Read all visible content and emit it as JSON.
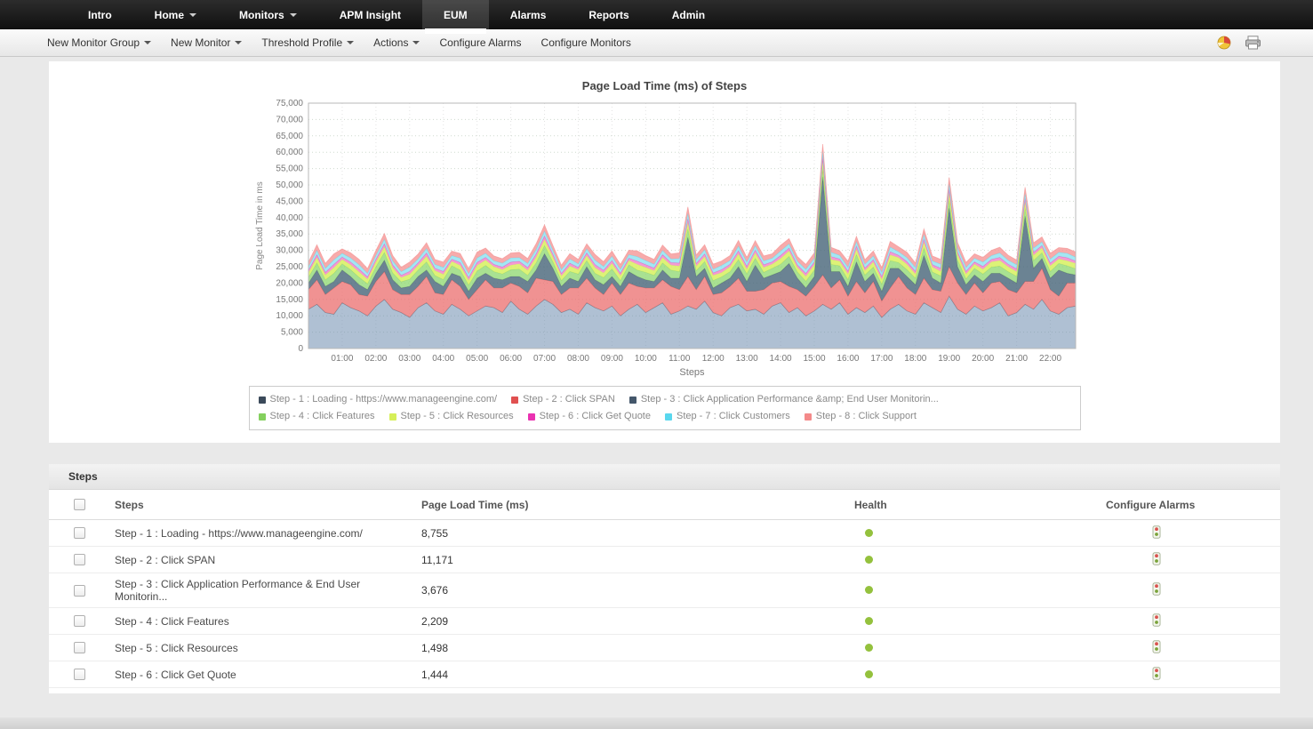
{
  "nav": {
    "items": [
      {
        "label": "Intro",
        "caret": false,
        "active": false
      },
      {
        "label": "Home",
        "caret": true,
        "active": false
      },
      {
        "label": "Monitors",
        "caret": true,
        "active": false
      },
      {
        "label": "APM Insight",
        "caret": false,
        "active": false
      },
      {
        "label": "EUM",
        "caret": false,
        "active": true
      },
      {
        "label": "Alarms",
        "caret": false,
        "active": false
      },
      {
        "label": "Reports",
        "caret": false,
        "active": false
      },
      {
        "label": "Admin",
        "caret": false,
        "active": false
      }
    ]
  },
  "toolbar": {
    "items": [
      {
        "label": "New Monitor Group",
        "caret": true
      },
      {
        "label": "New Monitor",
        "caret": true
      },
      {
        "label": "Threshold Profile",
        "caret": true
      },
      {
        "label": "Actions",
        "caret": true
      },
      {
        "label": "Configure Alarms",
        "caret": false
      },
      {
        "label": "Configure Monitors",
        "caret": false
      }
    ]
  },
  "chart_data": {
    "type": "area",
    "stacked": true,
    "title": "Page Load Time (ms) of Steps",
    "ylabel": "Page Load Time in ms",
    "xlabel": "Steps",
    "ylim": [
      0,
      75000
    ],
    "ytick_step": 5000,
    "grid": true,
    "legend_position": "bottom",
    "x_interval_minutes": 15,
    "x_ticks": [
      "01:00",
      "02:00",
      "03:00",
      "04:00",
      "05:00",
      "06:00",
      "07:00",
      "08:00",
      "09:00",
      "10:00",
      "11:00",
      "12:00",
      "13:00",
      "14:00",
      "15:00",
      "16:00",
      "17:00",
      "18:00",
      "19:00",
      "20:00",
      "21:00",
      "22:00"
    ],
    "legend_rows": [
      [
        0,
        1,
        2
      ],
      [
        3,
        4,
        5,
        6,
        7
      ]
    ],
    "series": [
      {
        "name": "Step - 1 : Loading - https://www.manageengine.com/",
        "marker": "#3b4a5a",
        "fill": "rgba(110,140,175,0.55)",
        "values": [
          12000,
          13500,
          11000,
          10500,
          14000,
          12500,
          11500,
          10000,
          13000,
          15000,
          12000,
          11000,
          9500,
          12500,
          14000,
          11500,
          10500,
          13500,
          12000,
          10000,
          11500,
          13000,
          12500,
          11000,
          14500,
          12000,
          10500,
          13000,
          15000,
          13500,
          11000,
          12000,
          10500,
          14000,
          12500,
          11500,
          13000,
          10000,
          12000,
          13500,
          11000,
          12500,
          14000,
          10500,
          11500,
          13000,
          12000,
          14500,
          11000,
          10000,
          12500,
          13500,
          11500,
          12000,
          10500,
          13000,
          14000,
          11000,
          12500,
          10000,
          11500,
          13500,
          12000,
          14000,
          10500,
          12500,
          11000,
          13000,
          9500,
          12000,
          13500,
          11500,
          10500,
          14000,
          12500,
          11000,
          16000,
          12000,
          10500,
          13000,
          11500,
          12500,
          14000,
          10000,
          11000,
          13500,
          12000,
          15000,
          11500,
          10500,
          12500,
          13000
        ]
      },
      {
        "name": "Step - 2 : Click SPAN",
        "marker": "#e05050",
        "fill": "rgba(235,110,110,0.75)",
        "values": [
          6000,
          7500,
          5500,
          8000,
          6500,
          7000,
          5000,
          6000,
          7500,
          8500,
          6000,
          5500,
          7000,
          6500,
          8000,
          5500,
          6000,
          7500,
          7000,
          5000,
          6500,
          8000,
          6000,
          7500,
          5500,
          7000,
          6500,
          8500,
          6000,
          7000,
          5500,
          6500,
          8000,
          7500,
          6000,
          5000,
          7000,
          6500,
          8000,
          5500,
          7500,
          6000,
          7000,
          8500,
          6500,
          9000,
          6000,
          7500,
          5500,
          7000,
          6500,
          8000,
          6000,
          5500,
          7500,
          7000,
          6500,
          8000,
          5500,
          6000,
          7500,
          9000,
          6500,
          7000,
          5500,
          8000,
          6000,
          7500,
          5000,
          6500,
          8500,
          7000,
          6000,
          7500,
          5500,
          6500,
          9000,
          8000,
          6000,
          7000,
          5500,
          7500,
          6500,
          8000,
          6000,
          7000,
          8500,
          9500,
          6500,
          5500,
          7500,
          7000
        ]
      },
      {
        "name": "Step - 3 : Click Application Performance &amp; End User Monitorin...",
        "marker": "#44576b",
        "fill": "rgba(70,100,120,0.80)",
        "values": [
          2000,
          3000,
          2500,
          2000,
          3500,
          2500,
          3000,
          2000,
          2500,
          3500,
          3000,
          2000,
          2500,
          3000,
          2000,
          3500,
          2500,
          2000,
          3000,
          2500,
          3500,
          2000,
          3000,
          2500,
          2000,
          3000,
          3500,
          2500,
          8000,
          4000,
          2500,
          3000,
          2000,
          3500,
          2500,
          3000,
          2000,
          2500,
          3500,
          3000,
          2500,
          2000,
          3000,
          2500,
          3500,
          12000,
          4000,
          2500,
          2000,
          3000,
          2500,
          3500,
          3000,
          8000,
          3500,
          2500,
          3000,
          7000,
          3500,
          2500,
          3000,
          30000,
          5000,
          2500,
          3000,
          6000,
          3500,
          2500,
          3000,
          6000,
          2500,
          3500,
          3000,
          7000,
          3500,
          2500,
          18000,
          5000,
          3000,
          2500,
          3500,
          3000,
          2500,
          3500,
          3000,
          20000,
          4000,
          3000,
          3500,
          8000,
          3000,
          2500
        ]
      },
      {
        "name": "Step - 4 : Click Features",
        "marker": "#84d05e",
        "fill": "rgba(140,215,110,0.75)",
        "values": [
          1800,
          2200,
          2000,
          2500,
          1900,
          2100,
          2300,
          1800,
          2000,
          2400,
          2100,
          1900,
          2200,
          2000,
          2500,
          1800,
          2100,
          2300,
          2000,
          1900,
          2200,
          2400,
          2000,
          1800,
          2100,
          2300,
          1900,
          2200,
          2500,
          2000,
          1800,
          2100,
          2300,
          1900,
          2000,
          2200,
          2400,
          1800,
          2100,
          2000,
          2300,
          1900,
          2200,
          2500,
          2000,
          2600,
          1800,
          2100,
          2300,
          1900,
          2000,
          2200,
          2400,
          2100,
          1800,
          2000,
          2300,
          2200,
          1900,
          2100,
          2000,
          2800,
          2200,
          1800,
          2100,
          2300,
          2000,
          1900,
          2200,
          2400,
          1800,
          2100,
          2000,
          2300,
          1900,
          2200,
          2600,
          2100,
          1800,
          2000,
          2300,
          1900,
          2200,
          2000,
          2100,
          2500,
          2400,
          1800,
          2100,
          2000,
          2300,
          1900
        ]
      },
      {
        "name": "Step - 5 : Click Resources",
        "marker": "#d6ef59",
        "fill": "rgba(215,240,95,0.85)",
        "values": [
          1400,
          1600,
          1500,
          1700,
          1300,
          1500,
          1600,
          1400,
          1500,
          1700,
          1600,
          1300,
          1500,
          1400,
          1700,
          1500,
          1600,
          1300,
          1400,
          1500,
          1700,
          1600,
          1500,
          1300,
          1400,
          1600,
          1500,
          1700,
          1800,
          1500,
          1400,
          1600,
          1300,
          1500,
          1700,
          1400,
          1600,
          1500,
          1300,
          1700,
          1500,
          1400,
          1600,
          1500,
          1700,
          1900,
          1400,
          1500,
          1600,
          1300,
          1500,
          1700,
          1400,
          1600,
          1500,
          1300,
          1700,
          1600,
          1400,
          1500,
          1600,
          2000,
          1500,
          1400,
          1700,
          1600,
          1300,
          1500,
          1400,
          1700,
          1500,
          1600,
          1300,
          1700,
          1500,
          1400,
          1900,
          1600,
          1500,
          1300,
          1400,
          1600,
          1700,
          1500,
          1400,
          1800,
          1600,
          1500,
          1700,
          1400,
          1500,
          1600
        ]
      },
      {
        "name": "Step - 6 : Click Get Quote",
        "marker": "#ea32b1",
        "fill": "rgba(240,130,200,0.80)",
        "values": [
          700,
          900,
          800,
          1000,
          750,
          850,
          900,
          700,
          800,
          950,
          850,
          700,
          900,
          800,
          1000,
          750,
          850,
          700,
          900,
          800,
          950,
          850,
          700,
          800,
          900,
          750,
          850,
          1000,
          1100,
          800,
          750,
          900,
          700,
          850,
          950,
          800,
          900,
          750,
          700,
          1000,
          850,
          800,
          900,
          750,
          950,
          1200,
          800,
          850,
          700,
          900,
          750,
          1000,
          850,
          900,
          800,
          700,
          950,
          900,
          750,
          850,
          800,
          1300,
          900,
          700,
          850,
          950,
          800,
          750,
          900,
          1000,
          700,
          850,
          800,
          950,
          750,
          900,
          1200,
          850,
          800,
          700,
          900,
          750,
          950,
          800,
          850,
          1100,
          900,
          700,
          850,
          800,
          950,
          750
        ]
      },
      {
        "name": "Step - 7 : Click Customers",
        "marker": "#59d7ee",
        "fill": "rgba(140,225,240,0.80)",
        "values": [
          1100,
          1300,
          1200,
          1400,
          1150,
          1250,
          1300,
          1100,
          1200,
          1350,
          1250,
          1100,
          1300,
          1200,
          1400,
          1150,
          1250,
          1100,
          1300,
          1200,
          1350,
          1250,
          1100,
          1200,
          1300,
          1150,
          1250,
          1400,
          1500,
          1200,
          1150,
          1300,
          1100,
          1250,
          1350,
          1200,
          1300,
          1150,
          1100,
          1400,
          1250,
          1200,
          1300,
          1150,
          1350,
          1600,
          1200,
          1250,
          1100,
          1300,
          1150,
          1400,
          1250,
          1300,
          1200,
          1100,
          1350,
          1300,
          1150,
          1250,
          1200,
          1700,
          1300,
          1100,
          1250,
          1350,
          1200,
          1150,
          1300,
          1400,
          1100,
          1250,
          1200,
          1350,
          1150,
          1300,
          1600,
          1250,
          1200,
          1100,
          1300,
          1150,
          1350,
          1200,
          1250,
          1500,
          1300,
          1100,
          1250,
          1200,
          1350,
          1150
        ]
      },
      {
        "name": "Step - 8 : Click Support",
        "marker": "#f48a8a",
        "fill": "rgba(245,150,150,0.80)",
        "values": [
          1400,
          1700,
          1500,
          1800,
          1350,
          1550,
          1650,
          1400,
          1500,
          1750,
          1600,
          1350,
          1550,
          1450,
          1750,
          1500,
          1600,
          1350,
          1450,
          1500,
          1750,
          1600,
          1500,
          1350,
          1450,
          1600,
          1500,
          1750,
          1900,
          1500,
          1400,
          1600,
          1350,
          1500,
          1750,
          1450,
          1600,
          1500,
          1350,
          1750,
          1500,
          1450,
          1600,
          1500,
          1750,
          2000,
          1400,
          1500,
          1600,
          1350,
          1500,
          1750,
          1450,
          1600,
          1500,
          1350,
          1750,
          1600,
          1400,
          1500,
          1600,
          2200,
          1500,
          1400,
          1750,
          1600,
          1350,
          1500,
          1450,
          1750,
          1500,
          1600,
          1350,
          1750,
          1500,
          1450,
          2000,
          1600,
          1500,
          1350,
          1450,
          1600,
          1750,
          1500,
          1450,
          1900,
          1600,
          1500,
          1750,
          1450,
          1500,
          1600
        ]
      }
    ]
  },
  "steps_table": {
    "section_title": "Steps",
    "columns": [
      "Steps",
      "Page Load Time  (ms)",
      "Health",
      "Configure Alarms"
    ],
    "rows": [
      {
        "step": "Step - 1 : Loading - https://www.manageengine.com/",
        "load_time": "8,755",
        "health": "green"
      },
      {
        "step": "Step - 2 : Click SPAN",
        "load_time": "11,171",
        "health": "green"
      },
      {
        "step": "Step - 3 : Click Application Performance & End User Monitorin...",
        "load_time": "3,676",
        "health": "green"
      },
      {
        "step": "Step - 4 : Click Features",
        "load_time": "2,209",
        "health": "green"
      },
      {
        "step": "Step - 5 : Click Resources",
        "load_time": "1,498",
        "health": "green"
      },
      {
        "step": "Step - 6 : Click Get Quote",
        "load_time": "1,444",
        "health": "green"
      }
    ],
    "health_color": "#94c13d"
  }
}
